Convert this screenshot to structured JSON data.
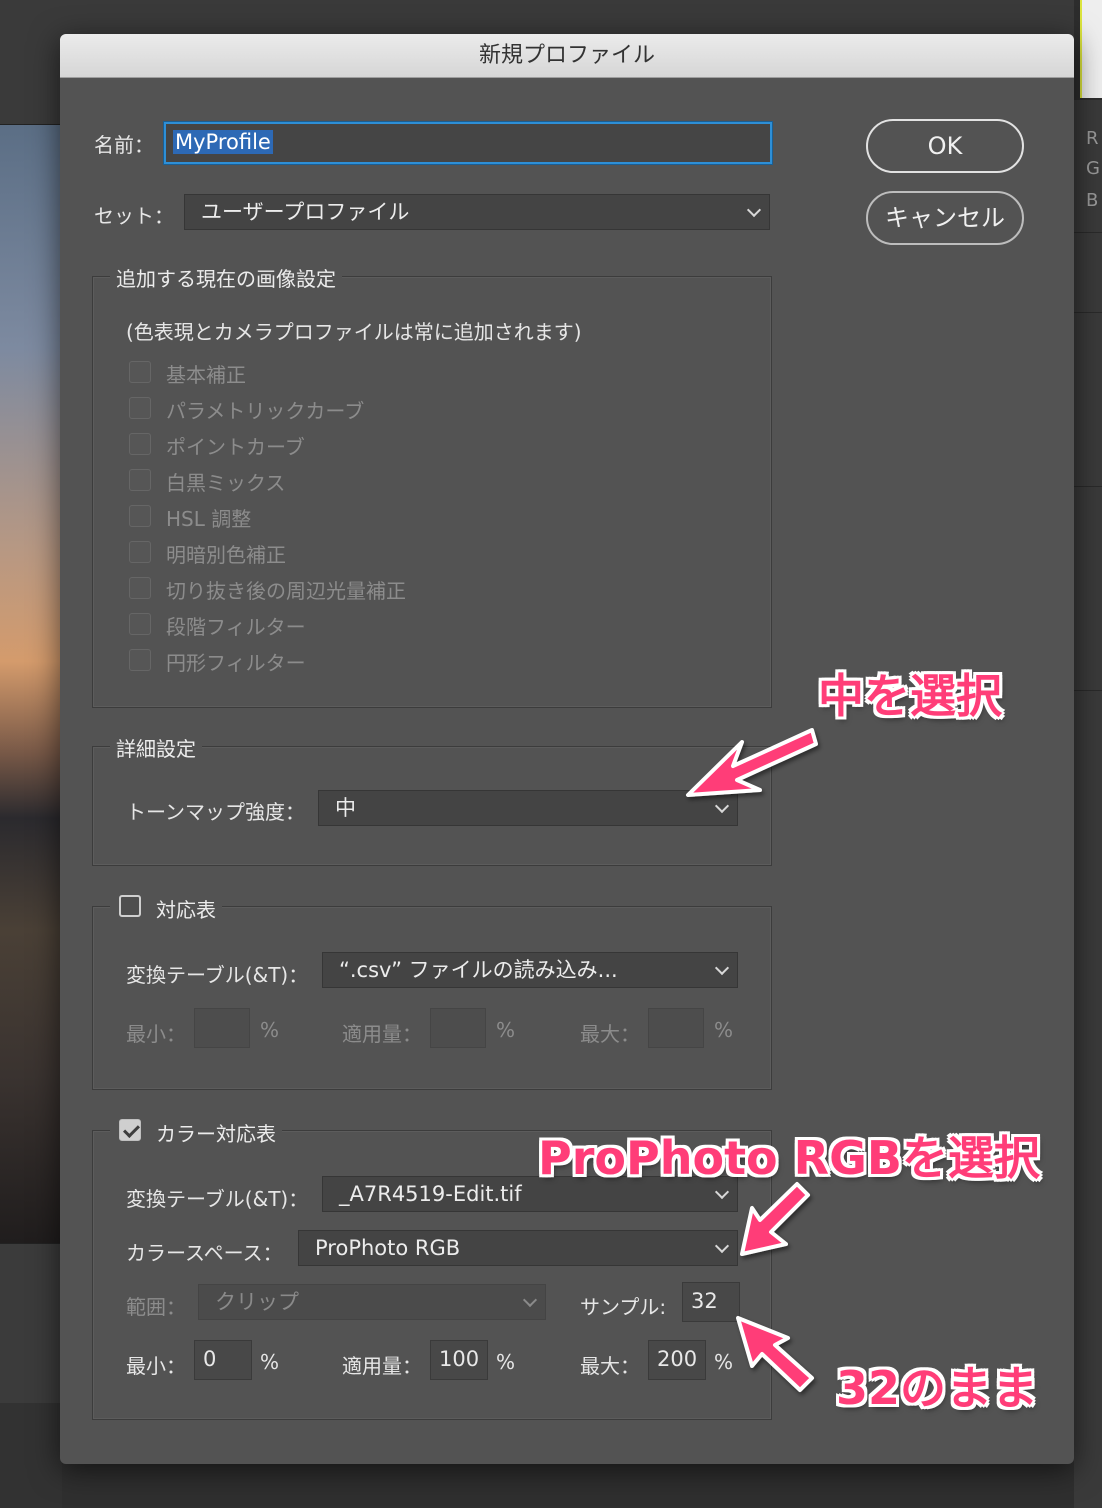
{
  "title": "新規プロファイル",
  "name_label": "名前：",
  "name_value": "MyProfile",
  "set_label": "セット：",
  "set_value": "ユーザープロファイル",
  "ok_label": "OK",
  "cancel_label": "キャンセル",
  "image_settings": {
    "legend": "追加する現在の画像設定",
    "note": "(色表現とカメラプロファイルは常に追加されます)",
    "items": [
      "基本補正",
      "パラメトリックカーブ",
      "ポイントカーブ",
      "白黒ミックス",
      "HSL 調整",
      "明暗別色補正",
      "切り抜き後の周辺光量補正",
      "段階フィルター",
      "円形フィルター"
    ]
  },
  "advanced": {
    "legend": "詳細設定",
    "tonemap_label": "トーンマップ強度：",
    "tonemap_value": "中"
  },
  "lookup": {
    "legend": "対応表",
    "table_label": "変換テーブル(&T)：",
    "table_value": "“.csv” ファイルの読み込み...",
    "min_label": "最小：",
    "amount_label": "適用量：",
    "max_label": "最大：",
    "percent": "%"
  },
  "color_lookup": {
    "legend": "カラー対応表",
    "table_label": "変換テーブル(&T)：",
    "table_value": "_A7R4519-Edit.tif",
    "colorspace_label": "カラースペース：",
    "colorspace_value": "ProPhoto RGB",
    "range_label": "範囲：",
    "range_value": "クリップ",
    "sample_label": "サンプル:",
    "sample_value": "32",
    "min_label": "最小：",
    "min_value": "0",
    "amount_label": "適用量：",
    "amount_value": "100",
    "max_label": "最大：",
    "max_value": "200",
    "percent": "%"
  },
  "annotations": {
    "select_medium": "中を選択",
    "select_prophoto": "ProPhoto RGBを選択",
    "keep_32": "32のまま",
    "color": "#ff3d78"
  },
  "background_letters": [
    "R",
    "G",
    "B"
  ]
}
